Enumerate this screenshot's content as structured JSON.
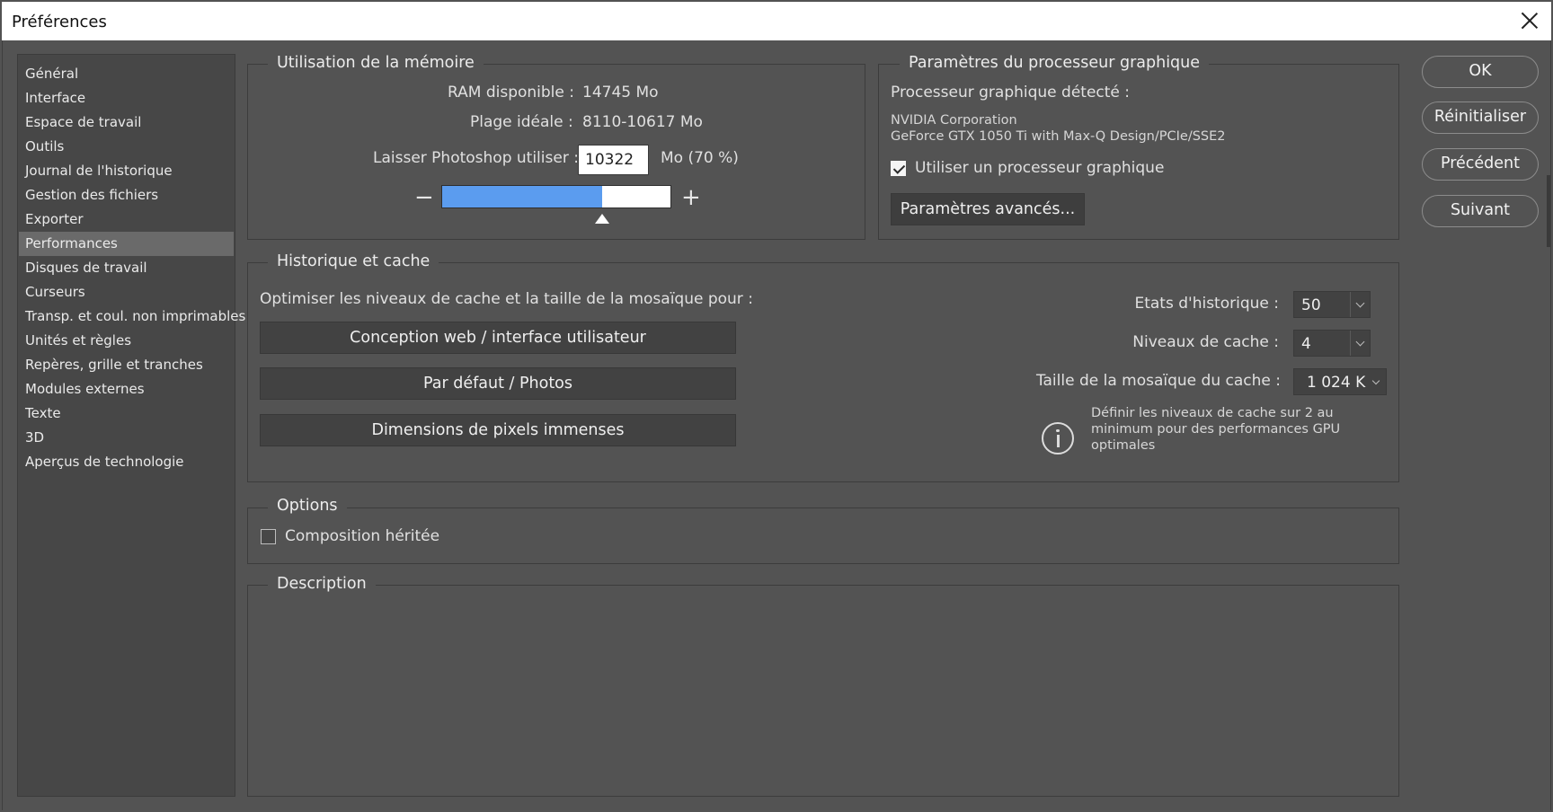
{
  "window": {
    "title": "Préférences"
  },
  "sidebar": {
    "items": [
      {
        "label": "Général"
      },
      {
        "label": "Interface"
      },
      {
        "label": "Espace de travail"
      },
      {
        "label": "Outils"
      },
      {
        "label": "Journal de l'historique"
      },
      {
        "label": "Gestion des fichiers"
      },
      {
        "label": "Exporter"
      },
      {
        "label": "Performances",
        "selected": true
      },
      {
        "label": "Disques de travail"
      },
      {
        "label": "Curseurs"
      },
      {
        "label": "Transp. et coul. non imprimables"
      },
      {
        "label": "Unités et règles"
      },
      {
        "label": "Repères, grille et tranches"
      },
      {
        "label": "Modules externes"
      },
      {
        "label": "Texte"
      },
      {
        "label": "3D"
      },
      {
        "label": "Aperçus de technologie"
      }
    ]
  },
  "memory": {
    "title": "Utilisation de la mémoire",
    "ram_label": "RAM disponible :",
    "ram_value": "14745 Mo",
    "ideal_label": "Plage idéale :",
    "ideal_value": "8110-10617 Mo",
    "let_label": "Laisser Photoshop utiliser :",
    "let_value": "10322",
    "let_unit": "Mo (70 %)",
    "slider_percent": 70,
    "minus": "−",
    "plus": "+"
  },
  "gpu": {
    "title": "Paramètres du processeur graphique",
    "detected_label": "Processeur graphique détecté :",
    "vendor": "NVIDIA Corporation",
    "model": "GeForce GTX 1050 Ti with Max-Q Design/PCIe/SSE2",
    "use_gpu_label": "Utiliser un processeur graphique",
    "use_gpu_checked": true,
    "advanced_button": "Paramètres avancés..."
  },
  "history": {
    "title": "Historique et cache",
    "optimize_label": "Optimiser les niveaux de cache et la taille de la mosaïque pour :",
    "buttons": [
      "Conception web / interface utilisateur",
      "Par défaut / Photos",
      "Dimensions de pixels immenses"
    ],
    "states_label": "Etats d'historique :",
    "states_value": "50",
    "cache_levels_label": "Niveaux de cache :",
    "cache_levels_value": "4",
    "tile_size_label": "Taille de la mosaïque du cache :",
    "tile_size_value": "1 024 K",
    "info_line1": "Définir les niveaux de cache sur 2 au",
    "info_line2": "minimum pour des performances GPU",
    "info_line3": "optimales"
  },
  "options": {
    "title": "Options",
    "legacy_label": "Composition héritée",
    "legacy_checked": false
  },
  "description": {
    "title": "Description"
  },
  "actions": {
    "ok": "OK",
    "reset": "Réinitialiser",
    "prev": "Précédent",
    "next": "Suivant"
  },
  "colors": {
    "background": "#535353",
    "slider_fill": "#5b9cef",
    "sidebar_selected": "#6a6a6a"
  }
}
